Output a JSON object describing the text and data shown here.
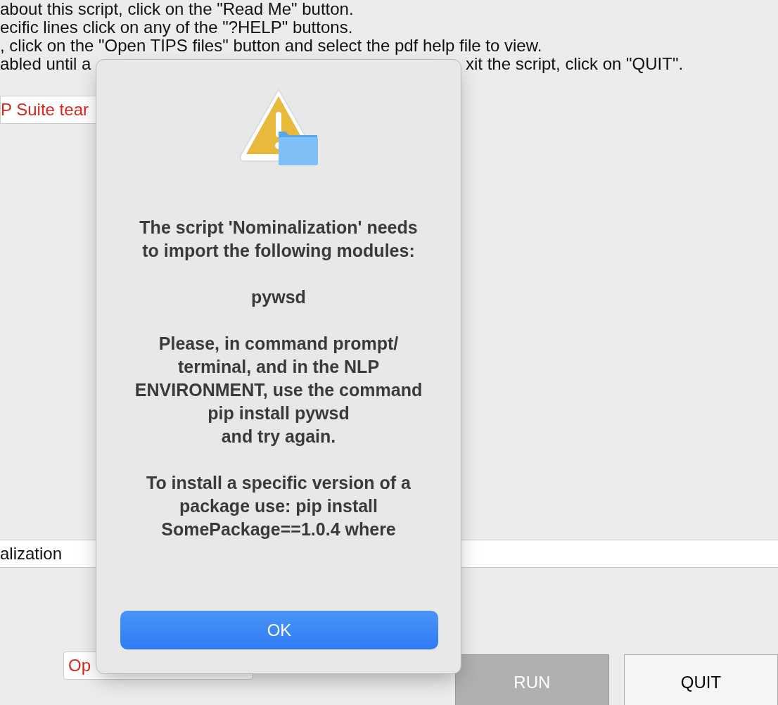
{
  "background": {
    "instructions": [
      "about this script, click on the \"Read Me\" button.",
      "ecific lines click on any of the \"?HELP\" buttons.",
      ", click on the \"Open TIPS files\" button and select the pdf help file to view."
    ],
    "instruction_cut_left": "abled until a",
    "instruction_cut_right": "xit the script, click on \"QUIT\".",
    "team_button": "P Suite tear",
    "script_field": {
      "value": "alization"
    },
    "tips_button": "Op",
    "run_button": {
      "label": "RUN",
      "disabled": true
    },
    "quit_button": "QUIT"
  },
  "dialog": {
    "paragraphs": [
      [
        "The script 'Nominalization' needs",
        "to import the following modules:"
      ],
      [
        "pywsd"
      ],
      [
        "Please, in command prompt/",
        "terminal, and in the NLP",
        "ENVIRONMENT, use the command",
        "pip install pywsd",
        "and try again."
      ],
      [
        "To install a specific version of a",
        "package use: pip install",
        "SomePackage==1.0.4 where"
      ]
    ],
    "ok_button": "OK"
  }
}
